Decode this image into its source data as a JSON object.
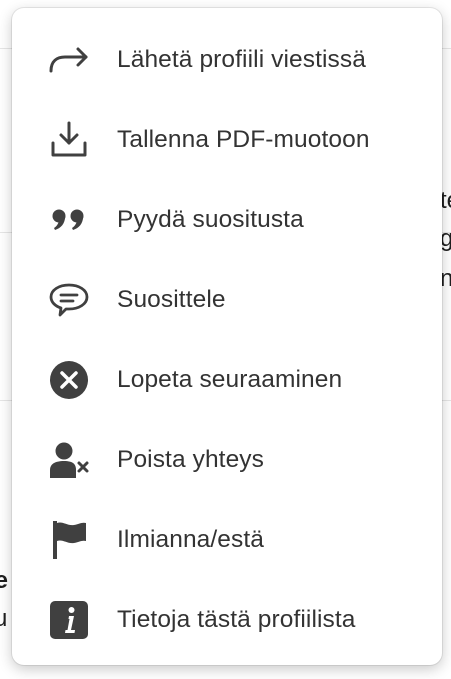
{
  "background": {
    "fragments": [
      "te",
      "g",
      "n",
      "ie",
      "u"
    ]
  },
  "menu": {
    "items": [
      {
        "label": "Lähetä profiili viestissä",
        "icon": "share-arrow-icon"
      },
      {
        "label": "Tallenna PDF-muotoon",
        "icon": "download-icon"
      },
      {
        "label": "Pyydä suositusta",
        "icon": "quote-icon"
      },
      {
        "label": "Suosittele",
        "icon": "speech-bubble-icon"
      },
      {
        "label": "Lopeta seuraaminen",
        "icon": "close-circle-icon"
      },
      {
        "label": "Poista yhteys",
        "icon": "remove-person-icon"
      },
      {
        "label": "Ilmianna/estä",
        "icon": "flag-icon"
      },
      {
        "label": "Tietoja tästä profiilista",
        "icon": "info-icon"
      }
    ]
  }
}
